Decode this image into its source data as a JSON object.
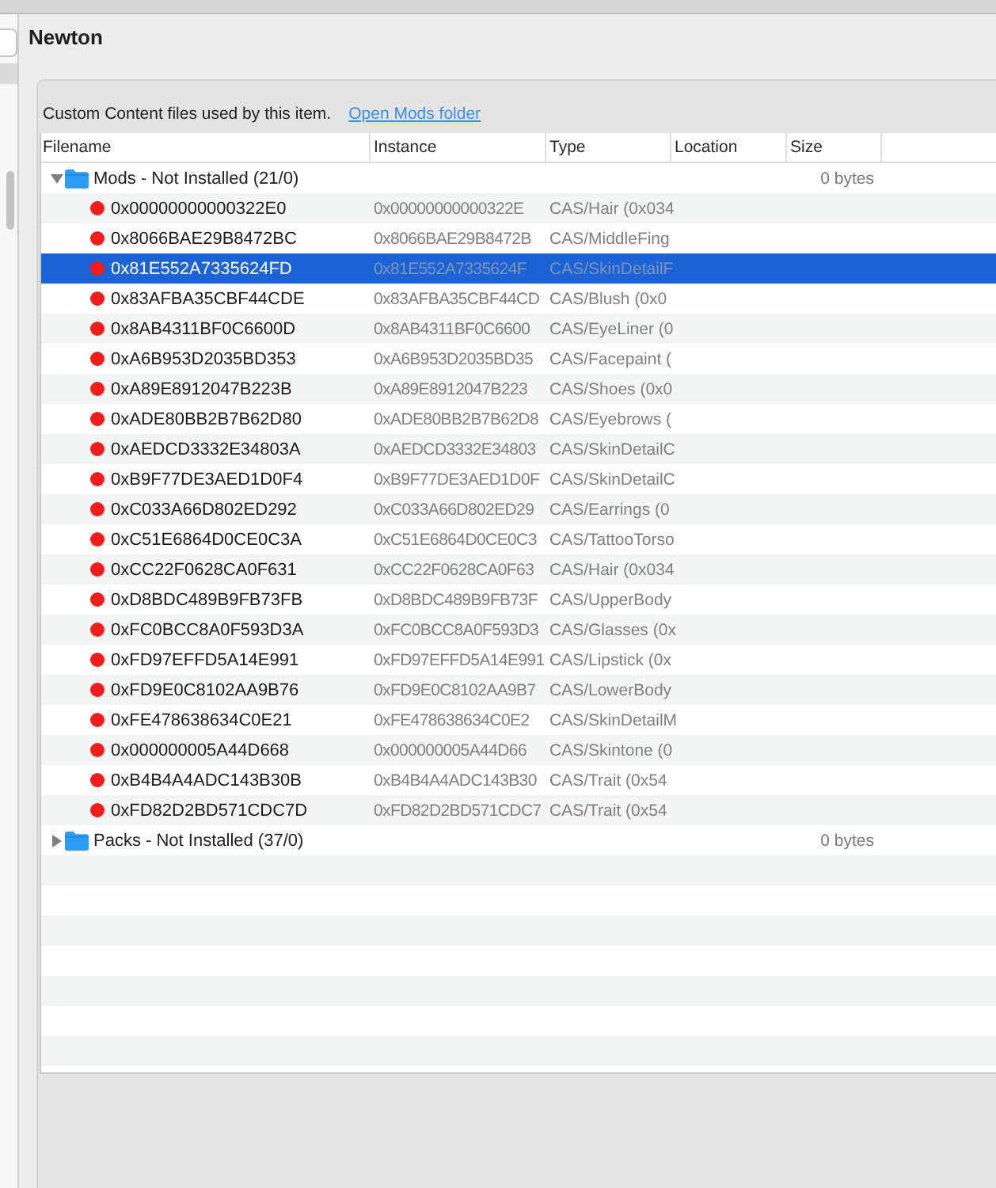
{
  "detail": {
    "title": "Newton",
    "description": "Custom Content files used by this item.",
    "link": "Open Mods folder"
  },
  "table": {
    "columns": [
      "Filename",
      "Instance",
      "Type",
      "Location",
      "Size"
    ],
    "rows": [
      {
        "label": "Mods - Not Installed (21/0)",
        "size": "0 bytes",
        "expanded": true,
        "selected": false,
        "children": [
          {
            "filename": "0x00000000000322E0",
            "instance": "0x00000000000322E",
            "type": "CAS/Hair (0x034",
            "selected": false
          },
          {
            "filename": "0x8066BAE29B8472BC",
            "instance": "0x8066BAE29B8472B",
            "type": "CAS/MiddleFing",
            "selected": false
          },
          {
            "filename": "0x81E552A7335624FD",
            "instance": "0x81E552A7335624F",
            "type": "CAS/SkinDetailF",
            "selected": true
          },
          {
            "filename": "0x83AFBA35CBF44CDE",
            "instance": "0x83AFBA35CBF44CD",
            "type": "CAS/Blush (0x0",
            "selected": false
          },
          {
            "filename": "0x8AB4311BF0C6600D",
            "instance": "0x8AB4311BF0C6600",
            "type": "CAS/EyeLiner (0",
            "selected": false
          },
          {
            "filename": "0xA6B953D2035BD353",
            "instance": "0xA6B953D2035BD35",
            "type": "CAS/Facepaint (",
            "selected": false
          },
          {
            "filename": "0xA89E8912047B223B",
            "instance": "0xA89E8912047B223",
            "type": "CAS/Shoes (0x0",
            "selected": false
          },
          {
            "filename": "0xADE80BB2B7B62D80",
            "instance": "0xADE80BB2B7B62D8",
            "type": "CAS/Eyebrows (",
            "selected": false
          },
          {
            "filename": "0xAEDCD3332E34803A",
            "instance": "0xAEDCD3332E34803",
            "type": "CAS/SkinDetailC",
            "selected": false
          },
          {
            "filename": "0xB9F77DE3AED1D0F4",
            "instance": "0xB9F77DE3AED1D0F",
            "type": "CAS/SkinDetailC",
            "selected": false
          },
          {
            "filename": "0xC033A66D802ED292",
            "instance": "0xC033A66D802ED29",
            "type": "CAS/Earrings (0",
            "selected": false
          },
          {
            "filename": "0xC51E6864D0CE0C3A",
            "instance": "0xC51E6864D0CE0C3",
            "type": "CAS/TattooTorso",
            "selected": false
          },
          {
            "filename": "0xCC22F0628CA0F631",
            "instance": "0xCC22F0628CA0F63",
            "type": "CAS/Hair (0x034",
            "selected": false
          },
          {
            "filename": "0xD8BDC489B9FB73FB",
            "instance": "0xD8BDC489B9FB73F",
            "type": "CAS/UpperBody",
            "selected": false
          },
          {
            "filename": "0xFC0BCC8A0F593D3A",
            "instance": "0xFC0BCC8A0F593D3",
            "type": "CAS/Glasses (0x",
            "selected": false
          },
          {
            "filename": "0xFD97EFFD5A14E991",
            "instance": "0xFD97EFFD5A14E991",
            "type": "CAS/Lipstick (0x",
            "selected": false
          },
          {
            "filename": "0xFD9E0C8102AA9B76",
            "instance": "0xFD9E0C8102AA9B7",
            "type": "CAS/LowerBody",
            "selected": false
          },
          {
            "filename": "0xFE478638634C0E21",
            "instance": "0xFE478638634C0E2",
            "type": "CAS/SkinDetailM",
            "selected": false
          },
          {
            "filename": "0x000000005A44D668",
            "instance": "0x000000005A44D66",
            "type": "CAS/Skintone (0",
            "selected": false
          },
          {
            "filename": "0xB4B4A4ADC143B30B",
            "instance": "0xB4B4A4ADC143B30",
            "type": "CAS/Trait (0x54",
            "selected": false
          },
          {
            "filename": "0xFD82D2BD571CDC7D",
            "instance": "0xFD82D2BD571CDC7",
            "type": "CAS/Trait (0x54",
            "selected": false
          }
        ]
      },
      {
        "label": "Packs - Not Installed (37/0)",
        "size": "0 bytes",
        "expanded": false,
        "selected": false
      }
    ]
  }
}
